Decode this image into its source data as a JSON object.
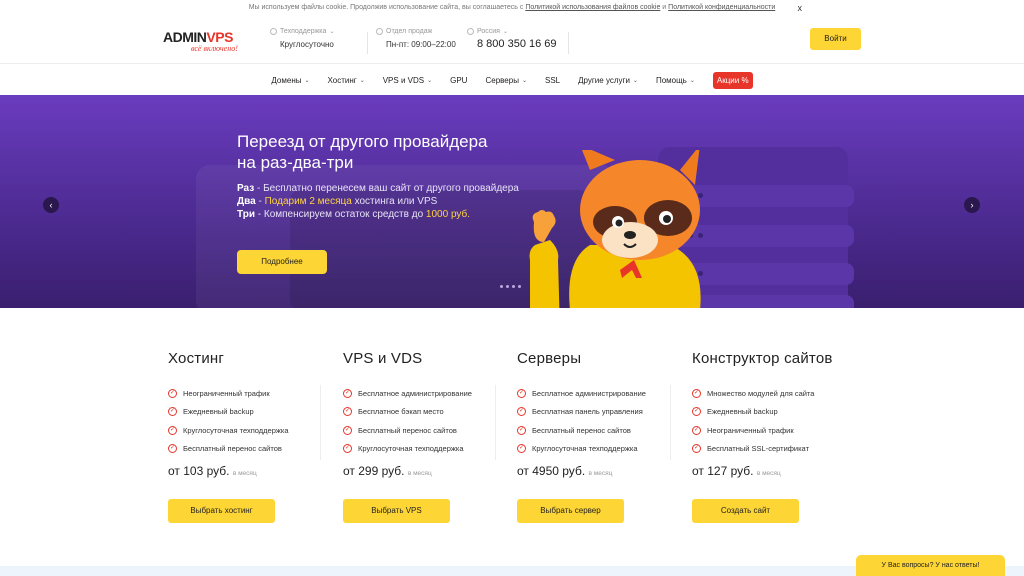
{
  "cookie": {
    "text": "Мы используем файлы cookie. Продолжив использование сайта, вы соглашаетесь с",
    "link1": "Политикой использования файлов cookie",
    "and": "и",
    "link2": "Политикой конфиденциальности",
    "close": "x"
  },
  "header": {
    "logo_main_a": "ADMIN",
    "logo_main_b": "VPS",
    "logo_sub": "всё включено!",
    "support_label": "Техподдержка",
    "support_value": "Круглосуточно",
    "sales_label": "Отдел продаж",
    "sales_value": "Пн-пт: 09:00–22:00",
    "region_label": "Россия",
    "phone": "8 800 350 16 69",
    "login": "Войти"
  },
  "nav": {
    "items": [
      "Домены",
      "Хостинг",
      "VPS и VDS",
      "GPU",
      "Серверы",
      "SSL",
      "Другие услуги",
      "Помощь"
    ],
    "promo": "Акции %"
  },
  "hero": {
    "title_line1": "Переезд от другого провайдера",
    "title_line2": "на раз-два-три",
    "l1_key": "Раз",
    "l1_text": " - Бесплатно перенесем ваш сайт от другого провайдера",
    "l2_key": "Два",
    "l2_pre": " - ",
    "l2_hl": "Подарим 2 месяца",
    "l2_post": " хостинга или VPS",
    "l3_key": "Три",
    "l3_pre": " - Компенсируем остаток средств до ",
    "l3_hl": "1000 руб.",
    "button": "Подробнее",
    "prev": "‹",
    "next": "›"
  },
  "products": [
    {
      "title": "Хостинг",
      "features": [
        "Неограниченный трафик",
        "Ежедневный backup",
        "Круглосуточная техподдержка",
        "Бесплатный перенос сайтов"
      ],
      "price": "от 103 руб.",
      "period": "в месяц",
      "button": "Выбрать хостинг"
    },
    {
      "title": "VPS и VDS",
      "features": [
        "Бесплатное администрирование",
        "Бесплатное бэкап место",
        "Бесплатный перенос сайтов",
        "Круглосуточная техподдержка"
      ],
      "price": "от 299 руб.",
      "period": "в месяц",
      "button": "Выбрать VPS"
    },
    {
      "title": "Серверы",
      "features": [
        "Бесплатное администрирование",
        "Бесплатная панель управления",
        "Бесплатный перенос сайтов",
        "Круглосуточная техподдержка"
      ],
      "price": "от 4950 руб.",
      "period": "в месяц",
      "button": "Выбрать сервер"
    },
    {
      "title": "Конструктор сайтов",
      "features": [
        "Множество модулей для сайта",
        "Ежедневный backup",
        "Неограниченный трафик",
        "Бесплатный SSL-сертификат"
      ],
      "price": "от 127 руб.",
      "period": "в месяц",
      "button": "Создать сайт"
    }
  ],
  "help_tab": "У Вас вопросы? У нас ответы!",
  "colors": {
    "accent_yellow": "#fdd535",
    "brand_red": "#e8352a",
    "hero_purple": "#5b35ad"
  }
}
